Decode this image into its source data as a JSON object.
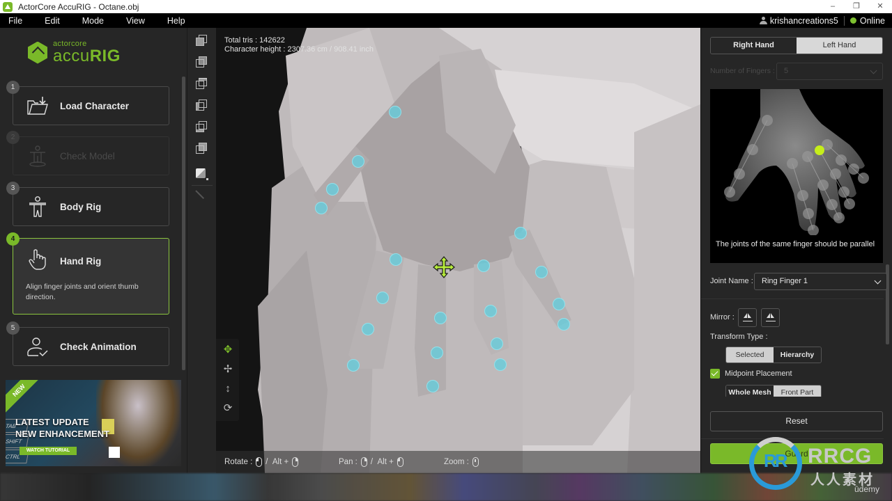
{
  "window": {
    "title": "ActorCore AccuRIG - Octane.obj",
    "controls": {
      "minimize": "–",
      "maximize": "❐",
      "close": "✕"
    }
  },
  "menu": {
    "items": [
      "File",
      "Edit",
      "Mode",
      "View",
      "Help"
    ],
    "username": "krishancreations5",
    "status": "Online",
    "status_color": "#7ec130"
  },
  "logo": {
    "small": "actorcore",
    "big_light": "accu",
    "big_bold": "RIG",
    "brand_color": "#7ab929"
  },
  "steps": [
    {
      "num": "1",
      "label": "Load Character",
      "icon": "folder-download-icon",
      "state": "normal"
    },
    {
      "num": "2",
      "label": "Check Model",
      "icon": "check-model-icon",
      "state": "disabled"
    },
    {
      "num": "3",
      "label": "Body Rig",
      "icon": "body-rig-icon",
      "state": "normal"
    },
    {
      "num": "4",
      "label": "Hand Rig",
      "icon": "hand-pointer-icon",
      "state": "active",
      "description": "Align finger joints and orient thumb direction."
    },
    {
      "num": "5",
      "label": "Check Animation",
      "icon": "user-check-icon",
      "state": "normal"
    }
  ],
  "banner": {
    "ribbon": "NEW",
    "line1": "LATEST UPDATE",
    "line2": "NEW ENHANCEMENT",
    "button": "WATCH TUTORIAL",
    "keys": [
      "TAB",
      "SHIFT",
      "CTRL"
    ]
  },
  "viewport": {
    "total_tris_label": "Total tris : 142622",
    "height_label": "Character height : 2307.36 cm / 908.41 inch",
    "hints": {
      "rotate": "Rotate",
      "pan": "Pan",
      "zoom": "Zoom",
      "colon": ":",
      "slash": "/",
      "alt": "Alt",
      "plus": "+"
    }
  },
  "right_panel": {
    "hand_options": [
      "Right Hand",
      "Left Hand"
    ],
    "selected_hand": "Left Hand",
    "fingers_label": "Number of Fingers :",
    "fingers_value": "5",
    "preview_caption": "The joints of the same finger should be parallel",
    "joint_name_label": "Joint Name :",
    "joint_name_value": "Ring Finger 1",
    "mirror_label": "Mirror :",
    "transform_type_label": "Transform Type :",
    "transform_options": [
      "Selected",
      "Hierarchy"
    ],
    "transform_selected": "Selected",
    "midpoint_label": "Midpoint Placement",
    "midpoint_checked": true,
    "placement_options": [
      "Whole Mesh",
      "Front Part"
    ],
    "placement_selected": "Front Part",
    "reset_label": "Reset",
    "primary_label": "Guard",
    "accent_color": "#7ab929"
  },
  "watermark": {
    "logo": "RR",
    "name": "RRCG",
    "sub": "人人素材",
    "udemy": "ûdemy"
  }
}
